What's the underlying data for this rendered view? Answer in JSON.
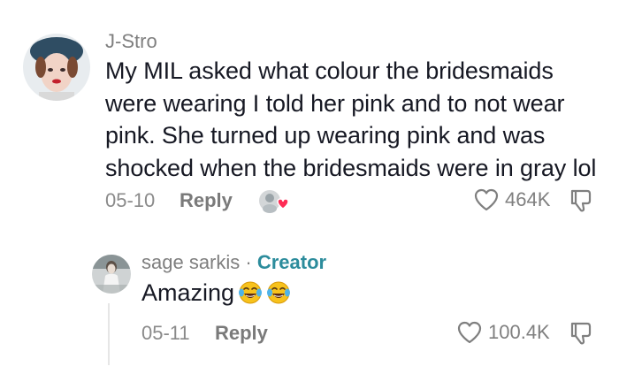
{
  "comment": {
    "username": "J-Stro",
    "text": "My MIL asked what colour the bridesmaids were wearing I told her pink and to not wear pink. She turned up wearing pink and was shocked when the bridesmaids were in gray lol",
    "date": "05-10",
    "reply_label": "Reply",
    "likes": "464K",
    "avatar_icon": "user-avatar-photo",
    "creator_liked_icon": "creator-liked-heart-badge"
  },
  "reply": {
    "username": "sage sarkis",
    "separator": "·",
    "badge": "Creator",
    "text": "Amazing",
    "emojis": [
      "face-with-tears-of-joy-icon",
      "face-with-tears-of-joy-icon"
    ],
    "date": "05-11",
    "reply_label": "Reply",
    "likes": "100.4K",
    "avatar_icon": "creator-avatar-photo"
  },
  "colors": {
    "text": "#161823",
    "muted": "#8a8a8a",
    "creator_badge": "#2c8c9c",
    "liked_heart": "#fe2c55",
    "emoji_yellow": "#f7c21c"
  }
}
